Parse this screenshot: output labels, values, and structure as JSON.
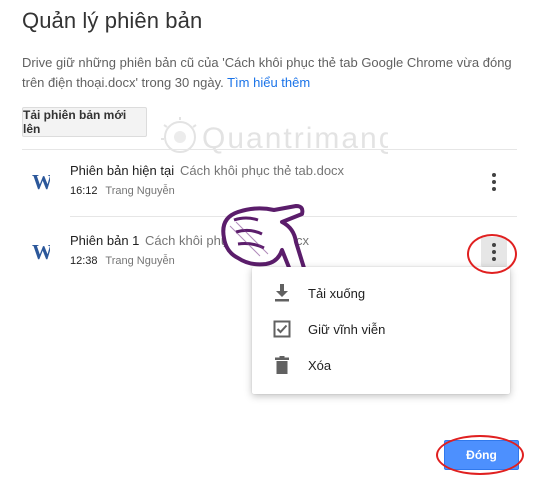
{
  "dialog": {
    "title": "Quản lý phiên bản",
    "description": "Drive giữ những phiên bản cũ của 'Cách khôi phục thẻ tab Google Chrome vừa đóng trên điện thoại.docx' trong 30 ngày.",
    "learn_more": "Tìm hiểu thêm",
    "upload_button": "Tải phiên bản mới lên",
    "close_button": "Đóng"
  },
  "versions": [
    {
      "name": "Phiên bản hiện tại",
      "file": "Cách khôi phục thẻ tab.docx",
      "time": "16:12",
      "author": "Trang Nguyễn",
      "icon": "word-doc-icon"
    },
    {
      "name": "Phiên bản 1",
      "file": "Cách khôi phục thẻ tab.docx",
      "time": "12:38",
      "author": "Trang Nguyễn",
      "icon": "word-doc-icon"
    }
  ],
  "context_menu": {
    "items": [
      {
        "label": "Tải xuống",
        "icon": "download-icon"
      },
      {
        "label": "Giữ vĩnh viễn",
        "icon": "checkbox-icon"
      },
      {
        "label": "Xóa",
        "icon": "trash-icon"
      }
    ]
  },
  "watermark": {
    "text": "Quantrimang"
  },
  "colors": {
    "primary_button": "#4d90fe",
    "link": "#1a73e8",
    "annotation_circle": "#e02020",
    "word_icon": "#2b579a"
  }
}
